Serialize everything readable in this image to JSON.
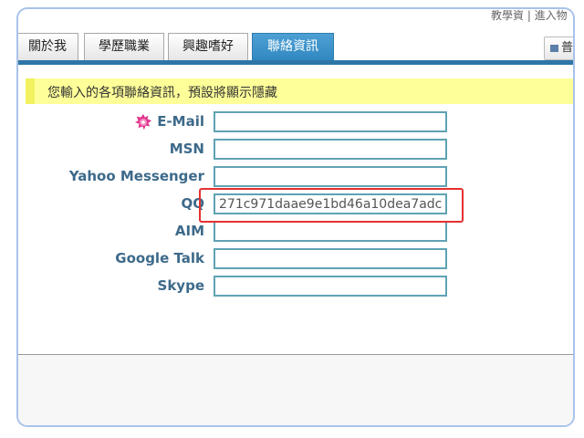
{
  "header": {
    "top_text": "教學資 | 進入物"
  },
  "tabs": [
    {
      "label": "關於我",
      "active": false
    },
    {
      "label": "學歷職業",
      "active": false
    },
    {
      "label": "興趣嗜好",
      "active": false
    },
    {
      "label": "聯絡資訊",
      "active": true
    }
  ],
  "right_button": {
    "label": "普",
    "icon": "card-icon"
  },
  "notice": {
    "text": "您輸入的各項聯絡資訊，預設將顯示隱藏"
  },
  "fields": [
    {
      "label": "E-Mail",
      "value": "",
      "required_icon": "star-badge-icon"
    },
    {
      "label": "MSN",
      "value": ""
    },
    {
      "label": "Yahoo Messenger",
      "value": ""
    },
    {
      "label": "QQ",
      "value": "271c971daae9e1bd46a10dea7adc"
    },
    {
      "label": "AIM",
      "value": ""
    },
    {
      "label": "Google Talk",
      "value": ""
    },
    {
      "label": "Skype",
      "value": ""
    }
  ],
  "colors": {
    "accent": "#2e75a8",
    "label": "#3d6a8a",
    "notice_bg": "#ffff99",
    "highlight": "#e53030"
  }
}
